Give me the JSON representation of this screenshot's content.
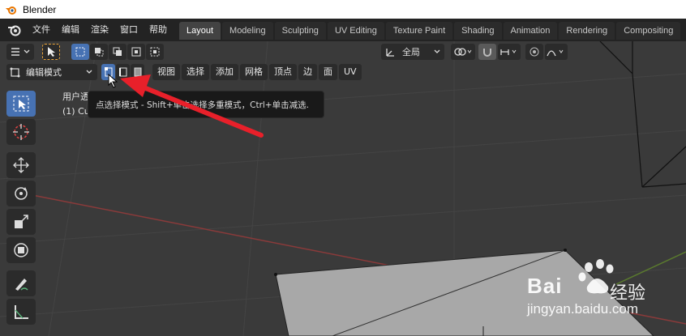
{
  "window": {
    "title": "Blender"
  },
  "menu": {
    "items": [
      "文件",
      "编辑",
      "渲染",
      "窗口",
      "帮助"
    ]
  },
  "workspaces": {
    "tabs": [
      "Layout",
      "Modeling",
      "Sculpting",
      "UV Editing",
      "Texture Paint",
      "Shading",
      "Animation",
      "Rendering",
      "Compositing"
    ],
    "active": "Layout"
  },
  "header": {
    "transform_orientation": "全局",
    "mode": "编辑模式",
    "view_menu": [
      "视图",
      "选择",
      "添加",
      "网格",
      "顶点",
      "边",
      "面",
      "UV"
    ]
  },
  "overlay": {
    "view_label": "用户透",
    "object_label": "(1) Cu"
  },
  "tooltip": {
    "text": "点选择模式 - Shift+单击选择多重模式，Ctrl+单击减选."
  },
  "watermark": {
    "brand": "Bai",
    "brand_cn": "经验",
    "url": "jingyan.baidu.com"
  },
  "colors": {
    "accent": "#4772b3",
    "arrow": "#e8202a",
    "viewport_bg": "#3a3a3a",
    "mesh_face": "#a8a8a8"
  }
}
